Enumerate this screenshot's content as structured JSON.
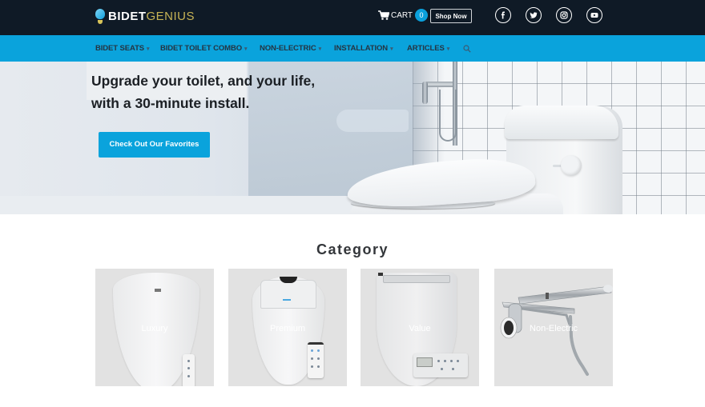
{
  "header": {
    "logo": {
      "part1": "BIDET",
      "part2": "GENIUS"
    },
    "cart": {
      "label": "CART",
      "count": "0"
    },
    "shop_now_label": "Shop Now",
    "social": [
      {
        "name": "facebook",
        "glyph": "f"
      },
      {
        "name": "twitter"
      },
      {
        "name": "instagram"
      },
      {
        "name": "youtube"
      }
    ]
  },
  "nav": {
    "items": [
      {
        "label": "BIDET SEATS",
        "has_dropdown": true
      },
      {
        "label": "BIDET TOILET COMBO",
        "has_dropdown": true
      },
      {
        "label": "NON-ELECTRIC",
        "has_dropdown": true
      },
      {
        "label": "INSTALLATION",
        "has_dropdown": true
      },
      {
        "label": "ARTICLES",
        "has_dropdown": true
      }
    ],
    "caret": "▾",
    "search_icon": "search-icon"
  },
  "hero": {
    "title_line1": "Upgrade your toilet, and your life,",
    "title_line2": "with a 30-minute install.",
    "cta_label": "Check Out Our Favorites"
  },
  "category": {
    "title": "Category",
    "cards": [
      {
        "label": "Luxury"
      },
      {
        "label": "Premium"
      },
      {
        "label": "Value"
      },
      {
        "label": "Non-Electric"
      }
    ]
  },
  "colors": {
    "topbar_bg": "#0f1a26",
    "accent": "#0aa3dc",
    "logo_gold": "#c8b455",
    "card_bg": "#e2e2e2"
  }
}
